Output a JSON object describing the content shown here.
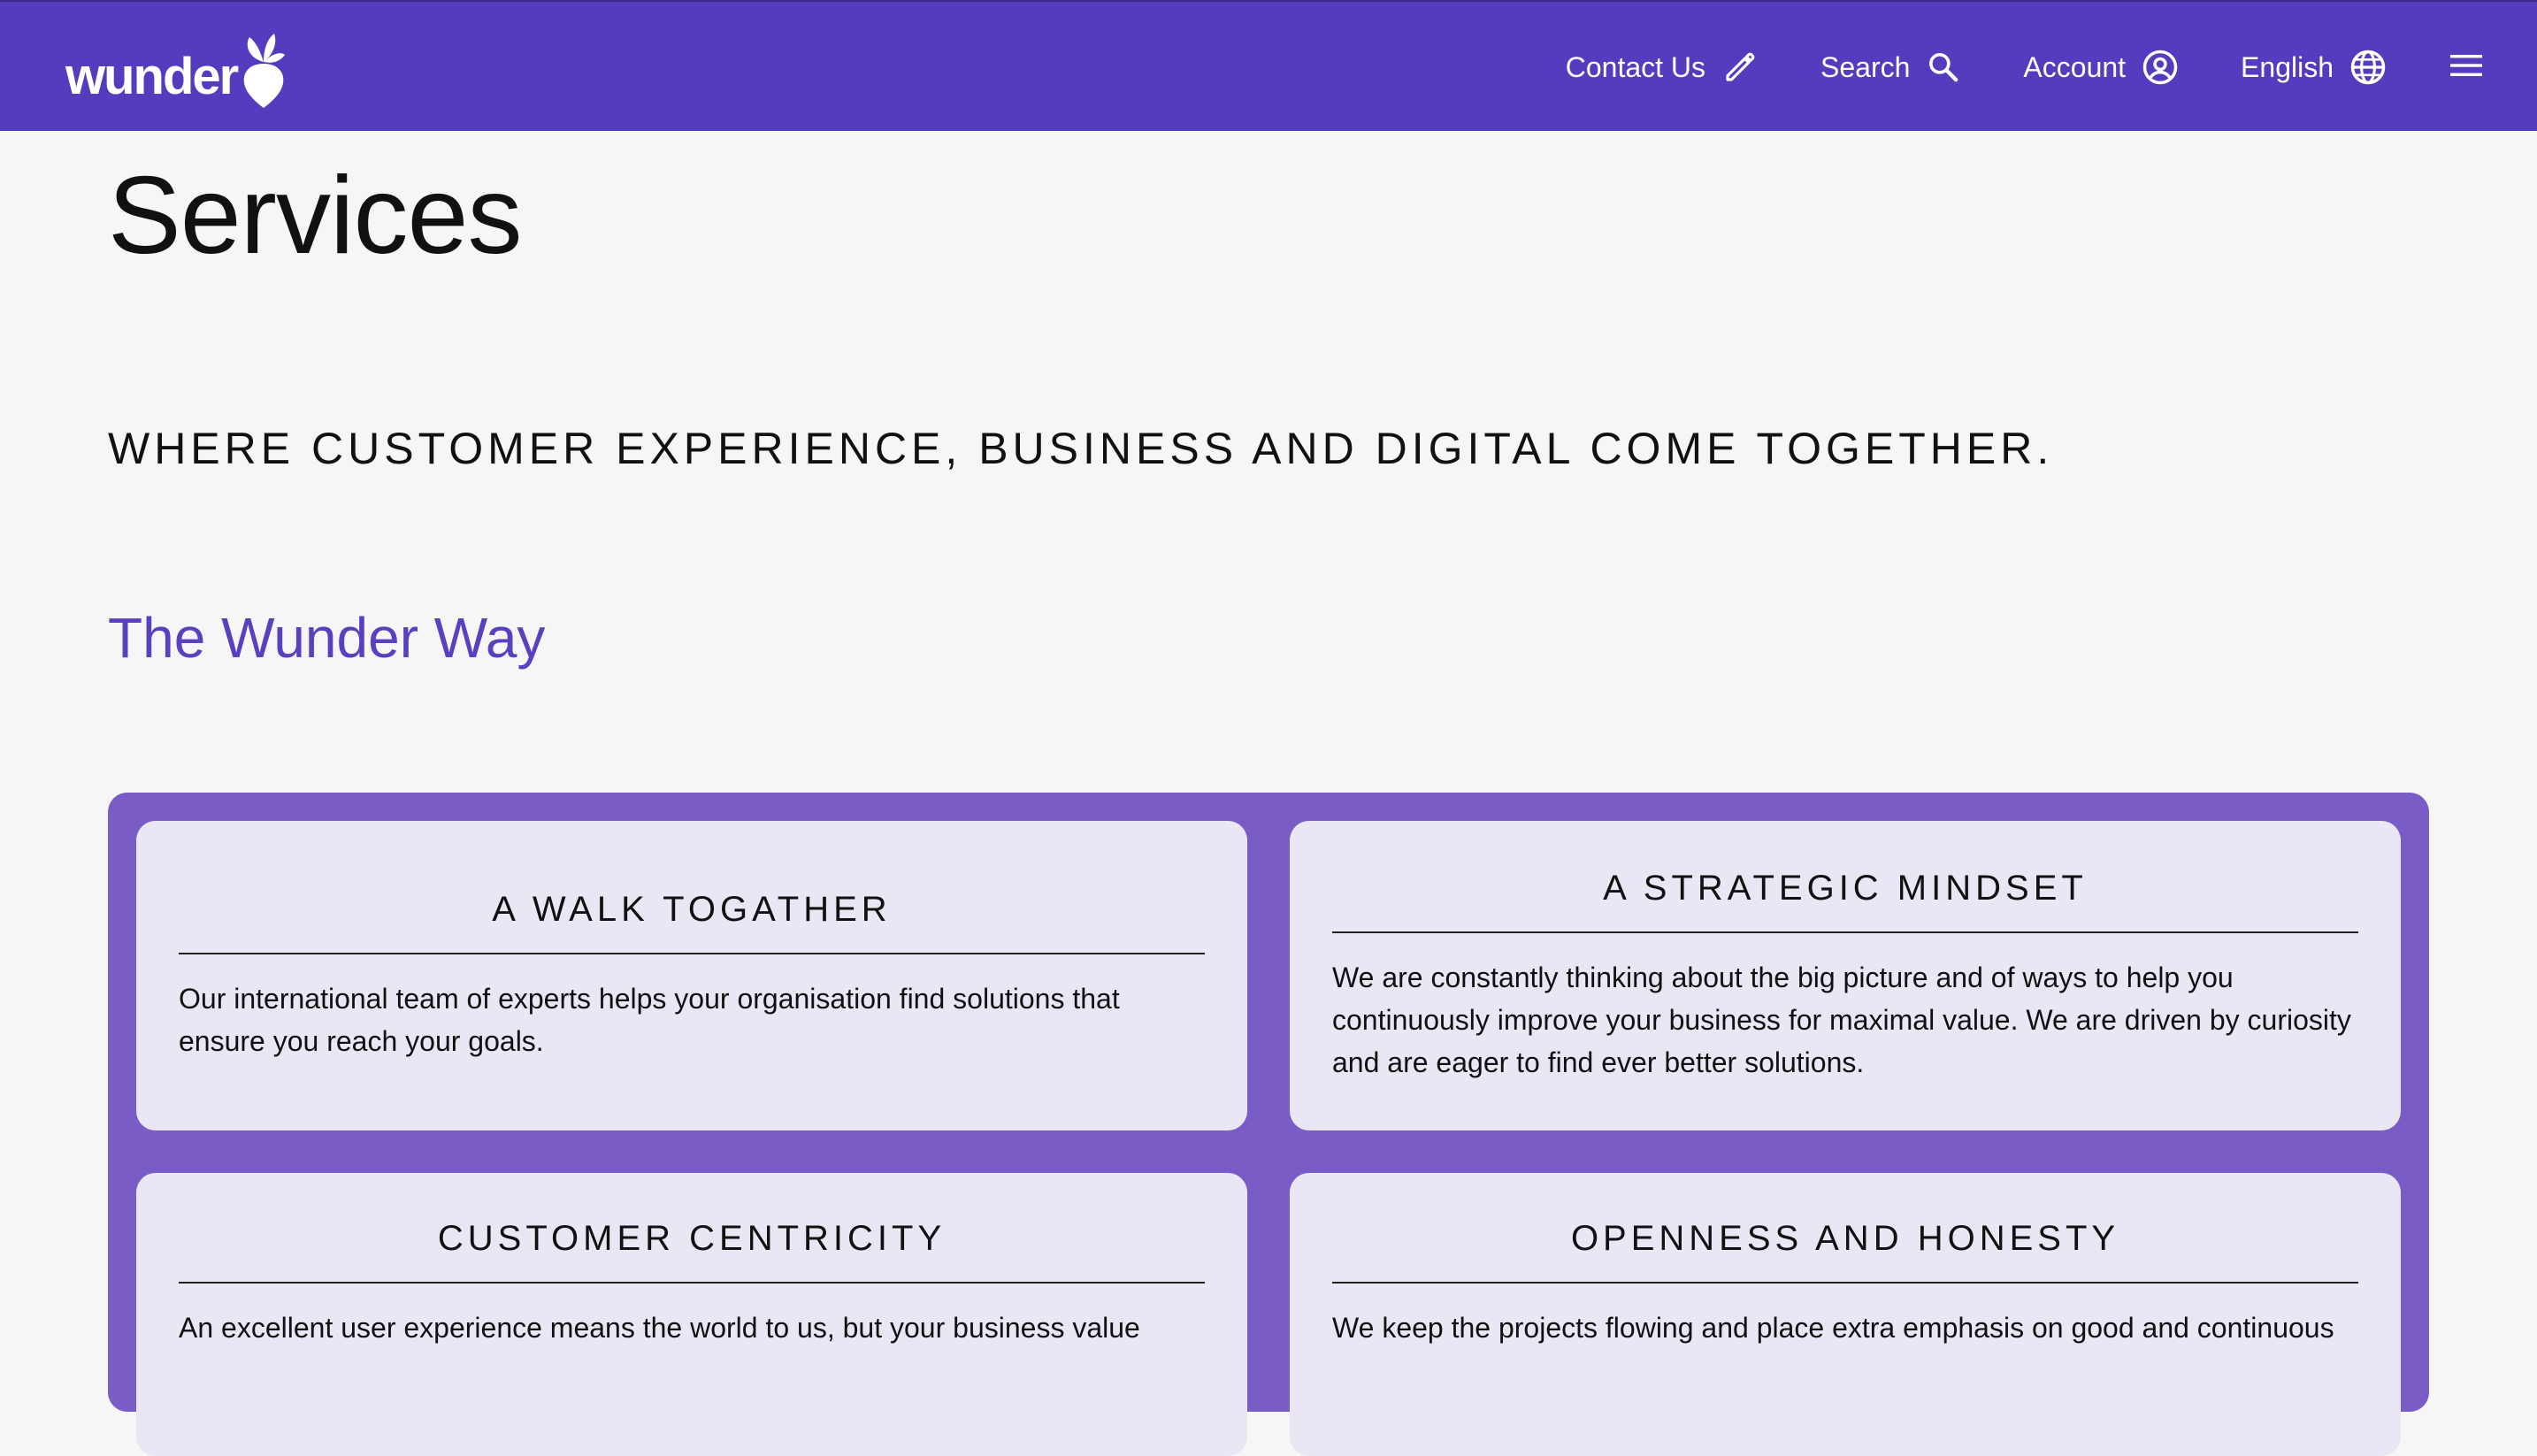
{
  "header": {
    "logo_text": "wunder",
    "nav": [
      {
        "label": "Contact Us",
        "icon": "pencil-icon"
      },
      {
        "label": "Search",
        "icon": "search-icon"
      },
      {
        "label": "Account",
        "icon": "account-icon"
      },
      {
        "label": "English",
        "icon": "globe-icon"
      }
    ],
    "menu_icon": "hamburger-menu-icon",
    "background": "#553bbd"
  },
  "page": {
    "title": "Services",
    "tagline": "WHERE CUSTOMER EXPERIENCE, BUSINESS AND DIGITAL COME TOGETHER.",
    "section_title": "The Wunder Way",
    "accent": "#5a3fc0",
    "panel_color": "#7a5cc7"
  },
  "cards": [
    {
      "title": "A WALK TOGATHER",
      "text": "Our international team of experts helps your organisation find solutions that ensure you reach your goals."
    },
    {
      "title": "A STRATEGIC MINDSET",
      "text": "We are constantly thinking about the big picture and of ways to help you continuously improve your business for maximal value. We are driven by curiosity and are eager to find ever better solutions."
    },
    {
      "title": "CUSTOMER CENTRICITY",
      "text": "An excellent user experience means the world to us, but your business value"
    },
    {
      "title": "OPENNESS AND HONESTY",
      "text": "We keep the projects flowing and place extra emphasis on good and continuous"
    }
  ]
}
